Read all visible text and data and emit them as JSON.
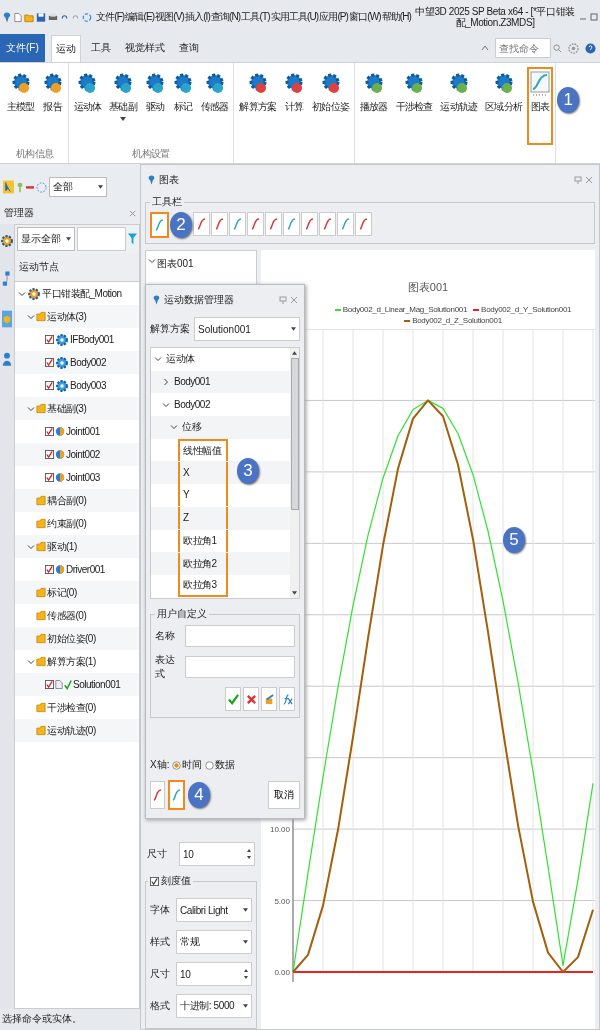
{
  "title_bar": {
    "menu": [
      "文件(F)",
      "编辑(E)",
      "视图(V)",
      "插入(I)",
      "查询(N)",
      "工具(T)",
      "实用工具(U)",
      "应用(P)",
      "窗口(W)",
      "帮助(H)"
    ],
    "title": "中望3D 2025 SP Beta x64 - [*平口钳装配_Motion.Z3MDS]"
  },
  "ribbon": {
    "tabs": [
      {
        "label": "文件(F)",
        "kind": "app",
        "selected": false
      },
      {
        "label": "运动",
        "kind": "tab",
        "selected": true
      },
      {
        "label": "工具",
        "kind": "tab",
        "selected": false
      },
      {
        "label": "视觉样式",
        "kind": "tab",
        "selected": false
      },
      {
        "label": "查询",
        "kind": "tab",
        "selected": false
      }
    ],
    "search": {
      "placeholder": "查找命令"
    },
    "groups": [
      {
        "label": "机构信息",
        "buttons": [
          {
            "label": "主模型",
            "highlighted": false
          },
          {
            "label": "报告",
            "highlighted": false
          }
        ]
      },
      {
        "label": "机构设置",
        "buttons": [
          {
            "label": "运动体",
            "highlighted": false
          },
          {
            "label": "基础副",
            "highlighted": false,
            "has_menu": true
          },
          {
            "label": "驱动",
            "highlighted": false
          },
          {
            "label": "标记",
            "highlighted": false
          },
          {
            "label": "传感器",
            "highlighted": false
          }
        ]
      },
      {
        "buttons": [
          {
            "label": "解算方案",
            "highlighted": false
          },
          {
            "label": "计算",
            "highlighted": false
          },
          {
            "label": "初始位姿",
            "highlighted": false
          }
        ]
      },
      {
        "buttons": [
          {
            "label": "播放器",
            "highlighted": false
          },
          {
            "label": "干涉检查",
            "highlighted": false
          },
          {
            "label": "运动轨迹",
            "highlighted": false
          },
          {
            "label": "区域分析",
            "highlighted": false
          },
          {
            "label": "图表",
            "highlighted": true,
            "callout": "1"
          }
        ]
      }
    ]
  },
  "left_toolbar": {
    "filter": "全部"
  },
  "manager": {
    "title": "管理器",
    "filter": "显示全部",
    "column": "运动节点",
    "tree": [
      {
        "label": "平口钳装配_Motion",
        "kind": "root",
        "expanded": true,
        "children": [
          {
            "label": "运动体(3)",
            "kind": "folder",
            "expanded": true,
            "children": [
              {
                "label": "IFBody001",
                "kind": "body",
                "checked": true
              },
              {
                "label": "Body002",
                "kind": "body",
                "checked": true
              },
              {
                "label": "Body003",
                "kind": "body",
                "checked": true
              }
            ]
          },
          {
            "label": "基础副(3)",
            "kind": "folder",
            "expanded": true,
            "children": [
              {
                "label": "Joint001",
                "kind": "joint",
                "checked": true
              },
              {
                "label": "Joint002",
                "kind": "joint",
                "checked": true
              },
              {
                "label": "Joint003",
                "kind": "joint",
                "checked": true
              }
            ]
          },
          {
            "label": "耦合副(0)",
            "kind": "folder"
          },
          {
            "label": "约束副(0)",
            "kind": "folder"
          },
          {
            "label": "驱动(1)",
            "kind": "folder",
            "expanded": true,
            "children": [
              {
                "label": "Driver001",
                "kind": "joint",
                "checked": true
              }
            ]
          },
          {
            "label": "标记(0)",
            "kind": "folder"
          },
          {
            "label": "传感器(0)",
            "kind": "folder"
          },
          {
            "label": "初始位姿(0)",
            "kind": "folder"
          },
          {
            "label": "解算方案(1)",
            "kind": "folder",
            "expanded": true,
            "children": [
              {
                "label": "Solution001",
                "kind": "solution",
                "checked": true
              }
            ]
          },
          {
            "label": "干涉检查(0)",
            "kind": "folder"
          },
          {
            "label": "运动轨迹(0)",
            "kind": "folder"
          }
        ]
      }
    ]
  },
  "chart_window": {
    "title": "图表",
    "toolbar": {
      "label": "工具栏",
      "buttons": [
        {
          "highlighted": true,
          "callout": "2"
        },
        {
          "highlighted": false
        },
        {
          "highlighted": false
        },
        {
          "highlighted": false
        },
        {
          "highlighted": false
        },
        {
          "highlighted": false
        },
        {
          "highlighted": false
        },
        {
          "highlighted": false
        },
        {
          "highlighted": false
        },
        {
          "highlighted": false
        },
        {
          "highlighted": false
        }
      ]
    },
    "settings": {
      "header": "图表001",
      "size_row": {
        "label": "尺寸",
        "value": "10",
        "kind": "spin"
      },
      "tick_group": {
        "label": "刻度值",
        "checked": true,
        "rows": [
          {
            "label": "字体",
            "value": "Calibri Light",
            "kind": "select"
          },
          {
            "label": "样式",
            "value": "常规",
            "kind": "select"
          },
          {
            "label": "尺寸",
            "value": "10",
            "kind": "spin"
          },
          {
            "label": "格式",
            "value": "十进制: 5000",
            "kind": "select"
          }
        ]
      }
    },
    "chart": {
      "callout": "5",
      "chart_data": {
        "type": "line",
        "title": "图表001",
        "grid": true,
        "legend": true,
        "ylim": [
          0,
          45
        ],
        "yticks": [
          {
            "value": 0,
            "label": "0.00"
          },
          {
            "value": 5,
            "label": "5.00"
          },
          {
            "value": 10,
            "label": "10.00"
          }
        ],
        "series": [
          {
            "name": "Body002_d_Linear_Mag_Solution001",
            "color": "#33e033",
            "values": [
              0,
              6.92,
              13.63,
              19.93,
              25.64,
              30.56,
              34.56,
              37.53,
              39.36,
              40.0,
              39.44,
              37.69,
              34.8,
              30.86,
              25.98,
              20.28,
              14.05,
              7.37,
              0.46,
              6.46,
              13.2
            ]
          },
          {
            "name": "Body002_d_Y_Solution001",
            "color": "#ee2020",
            "values": [
              0,
              0,
              0,
              0,
              0,
              0,
              0,
              0,
              0,
              0,
              0,
              0,
              0,
              0,
              0,
              0,
              0,
              0,
              0,
              0,
              0
            ]
          },
          {
            "name": "Body002_d_Z_Solution001",
            "color": "#a35f0c",
            "values": [
              0,
              1.2,
              4.65,
              9.95,
              16.43,
              23.35,
              29.86,
              35.23,
              38.73,
              40.0,
              38.89,
              35.5,
              30.29,
              23.8,
              16.87,
              10.28,
              4.93,
              1.36,
              0,
              1.04,
              4.36
            ]
          }
        ]
      }
    }
  },
  "dialog": {
    "title": "运动数据管理器",
    "solution": {
      "label": "解算方案",
      "value": "Solution001"
    },
    "callout": "3",
    "tree": [
      {
        "label": "运动体",
        "expanded": true,
        "children": [
          {
            "label": "Body001",
            "expanded": false
          },
          {
            "label": "Body002",
            "expanded": true,
            "children": [
              {
                "label": "位移",
                "expanded": true,
                "children": [
                  {
                    "label": "线性幅值",
                    "highlighted": true
                  },
                  {
                    "label": "X",
                    "highlighted": true
                  },
                  {
                    "label": "Y",
                    "highlighted": true
                  },
                  {
                    "label": "Z",
                    "highlighted": true
                  },
                  {
                    "label": "欧拉角1",
                    "highlighted": true
                  },
                  {
                    "label": "欧拉角2",
                    "highlighted": true
                  },
                  {
                    "label": "欧拉角3",
                    "highlighted": true
                  }
                ]
              }
            ]
          }
        ]
      }
    ],
    "user_defined": {
      "label": "用户自定义",
      "fields": [
        {
          "label": "名称"
        },
        {
          "label": "表达式"
        }
      ],
      "buttons": [
        {
          "kind": "confirm"
        },
        {
          "kind": "delete"
        },
        {
          "kind": "edit"
        },
        {
          "kind": "function"
        }
      ]
    },
    "x_axis": {
      "label": "X轴:",
      "options": [
        {
          "label": "时间",
          "selected": true
        },
        {
          "label": "数据",
          "selected": false
        }
      ]
    },
    "buttons": [
      {
        "highlighted": false
      },
      {
        "highlighted": true,
        "callout": "4"
      }
    ],
    "cancel": "取消"
  },
  "status": "选择命令或实体。"
}
